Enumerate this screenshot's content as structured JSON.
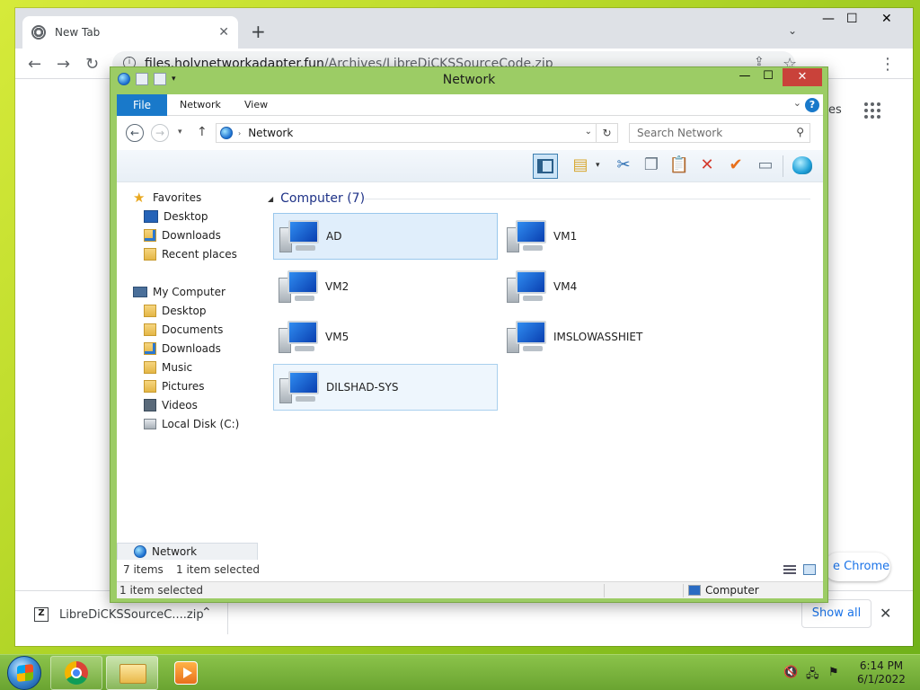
{
  "browser": {
    "tab_title": "New Tab",
    "tab_close": "✕",
    "new_tab": "+",
    "tab_search": "⌄",
    "window_controls": [
      "—",
      "☐",
      "✕"
    ],
    "url_host": "files.holynetworkadapter.fun",
    "url_path": "/Archives/LibreDiCKSSourceCode.zip",
    "nav_back": "←",
    "nav_forward": "→",
    "nav_reload": "↻",
    "share": "⇪",
    "star": "☆",
    "menu": "⋮",
    "content_partial_label": "es",
    "customize_chip_text": "e Chrome",
    "download": {
      "file_name": "LibreDiCKSSourceC....zip",
      "chevron": "⌃",
      "show_all_label": "Show all",
      "close": "✕"
    }
  },
  "explorer": {
    "title": "Network",
    "window_controls": {
      "minimize": "—",
      "maximize": "☐",
      "close": "✕"
    },
    "ribbon_tabs": [
      "File",
      "Network",
      "View"
    ],
    "ribbon_collapse": "⌄",
    "help": "?",
    "address": {
      "location": "Network",
      "separator": "›",
      "dropdown": "⌄",
      "refresh": "↻"
    },
    "search_placeholder": "Search Network",
    "search_icon": "⚲",
    "nav": {
      "back": "←",
      "forward": "→",
      "recent": "▾",
      "up": "↑",
      "favorites_label": "Favorites",
      "favorites": [
        "Desktop",
        "Downloads",
        "Recent places"
      ],
      "my_computer_label": "My Computer",
      "my_computer": [
        "Desktop",
        "Documents",
        "Downloads",
        "Music",
        "Pictures",
        "Videos",
        "Local Disk (C:)"
      ],
      "network_label": "Network"
    },
    "commands": {
      "properties_dropdown": "▾",
      "cut": "✂",
      "copy": "❐",
      "paste": "📋",
      "delete": "✕",
      "rename": "✔",
      "keyboard": "▭"
    },
    "group_header": "Computer (7)",
    "group_caret": "◢",
    "computers": [
      "AD",
      "VM1",
      "VM2",
      "VM4",
      "VM5",
      "IMSLOWASSHIET",
      "DILSHAD-SYS"
    ],
    "status": {
      "items_count": "7 items",
      "selection": "1 item selected",
      "bottom_left": "1 item selected",
      "bottom_right": "Computer"
    }
  },
  "taskbar": {
    "tray": {
      "volume": "🔇",
      "network": "🖧",
      "flag": "⚑"
    },
    "time": "6:14 PM",
    "date": "6/1/2022"
  },
  "colors": {
    "desktop": "#a4cf35",
    "explorer_frame": "#9ccc65",
    "file_tab": "#1979ca",
    "close_button": "#c9423a",
    "selection": "#e0eefb"
  },
  "icons": [
    "chrome-favicon",
    "network-globe-icon",
    "computer-icon",
    "folder-icon",
    "star-icon",
    "start-orb-icon",
    "chrome-icon",
    "explorer-icon",
    "media-player-icon"
  ]
}
